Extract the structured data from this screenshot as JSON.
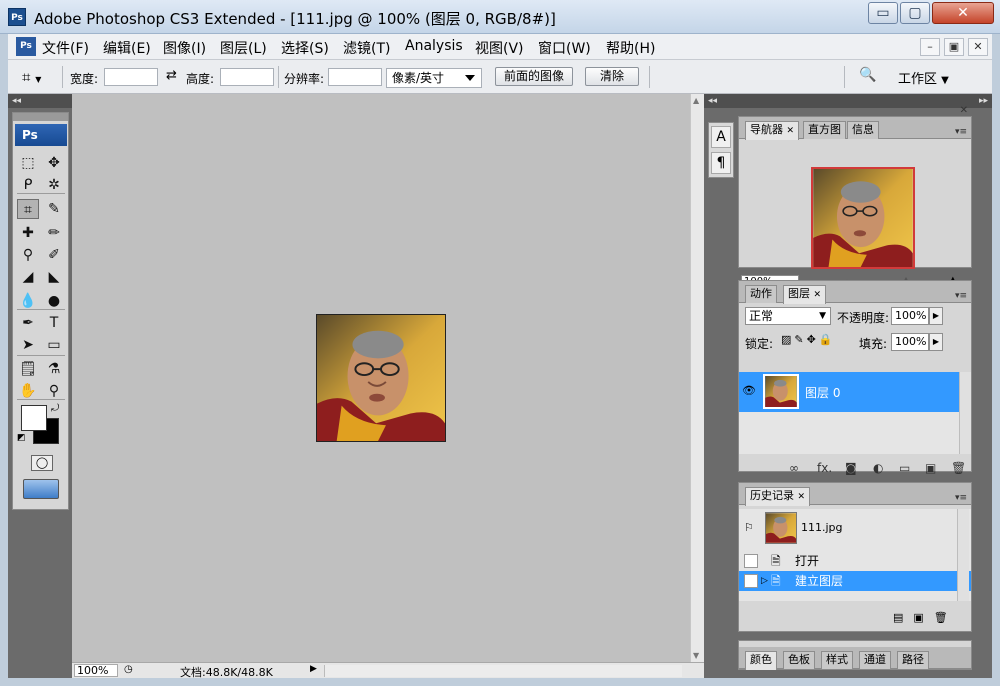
{
  "window": {
    "title": "Adobe Photoshop CS3 Extended - [111.jpg @ 100% (图层 0, RGB/8#)]",
    "app_icon": "Ps",
    "min_icon": "▭",
    "max_icon": "▢",
    "close_icon": "✕"
  },
  "menubar": {
    "logo": "Ps",
    "items": [
      "文件(F)",
      "编辑(E)",
      "图像(I)",
      "图层(L)",
      "选择(S)",
      "滤镜(T)",
      "Analysis",
      "视图(V)",
      "窗口(W)",
      "帮助(H)"
    ],
    "mdi_min": "–",
    "mdi_restore": "▣",
    "mdi_close": "✕"
  },
  "options": {
    "tool_icon": "crop-icon",
    "width_label": "宽度:",
    "width_value": "",
    "swap_icon": "⇄",
    "height_label": "高度:",
    "height_value": "",
    "resolution_label": "分辨率:",
    "resolution_value": "",
    "unit_select": "像素/英寸",
    "front_image_button": "前面的图像",
    "clear_button": "清除",
    "workspace_label": "工作区",
    "workspace_arrow": "▼"
  },
  "toolbox": {
    "logo": "Ps",
    "tools": [
      {
        "name": "marquee-tool-icon",
        "glyph": "⬚"
      },
      {
        "name": "move-tool-icon",
        "glyph": "✥"
      },
      {
        "name": "lasso-tool-icon",
        "glyph": "ᑭ"
      },
      {
        "name": "magic-wand-tool-icon",
        "glyph": "✲"
      },
      {
        "name": "crop-tool-icon",
        "glyph": "⌗"
      },
      {
        "name": "slice-tool-icon",
        "glyph": "✎"
      },
      {
        "name": "healing-brush-tool-icon",
        "glyph": "✚"
      },
      {
        "name": "brush-tool-icon",
        "glyph": "✏"
      },
      {
        "name": "clone-stamp-tool-icon",
        "glyph": "⚲"
      },
      {
        "name": "history-brush-tool-icon",
        "glyph": "✐"
      },
      {
        "name": "eraser-tool-icon",
        "glyph": "◢"
      },
      {
        "name": "paint-bucket-tool-icon",
        "glyph": "◣"
      },
      {
        "name": "blur-tool-icon",
        "glyph": "💧"
      },
      {
        "name": "dodge-tool-icon",
        "glyph": "●"
      },
      {
        "name": "pen-tool-icon",
        "glyph": "✒"
      },
      {
        "name": "type-tool-icon",
        "glyph": "T"
      },
      {
        "name": "path-selection-tool-icon",
        "glyph": "➤"
      },
      {
        "name": "rectangle-tool-icon",
        "glyph": "▭"
      },
      {
        "name": "notes-tool-icon",
        "glyph": "🗒"
      },
      {
        "name": "eyedropper-tool-icon",
        "glyph": "⚗"
      },
      {
        "name": "hand-tool-icon",
        "glyph": "✋"
      },
      {
        "name": "zoom-tool-icon",
        "glyph": "⚲"
      }
    ],
    "quick_mask_icon": "◯",
    "screen_mode_icon": "▭"
  },
  "dock": {
    "collapse_icon": "◂◂",
    "expand_icon": "▸▸",
    "character_icon": "A",
    "paragraph_icon": "¶"
  },
  "navigator": {
    "tabs": [
      "导航器",
      "直方图",
      "信息"
    ],
    "zoom_value": "100%",
    "zoom_out_icon": "▴",
    "zoom_in_icon": "▲"
  },
  "layers": {
    "tabs": [
      "动作",
      "图层"
    ],
    "blend_mode": "正常",
    "opacity_label": "不透明度:",
    "opacity_value": "100%",
    "lock_label": "锁定:",
    "fill_label": "填充:",
    "fill_value": "100%",
    "layer_name": "图层 0",
    "eye_icon": "👁",
    "footer_icons": [
      "∞",
      "fx.",
      "◙",
      "◐",
      "▭",
      "▣",
      "🗑"
    ]
  },
  "history": {
    "tabs": [
      "历史记录"
    ],
    "snapshot_name": "111.jpg",
    "steps": [
      "打开",
      "建立图层"
    ]
  },
  "bottom_panel": {
    "tabs": [
      "颜色",
      "色板",
      "样式",
      "通道",
      "路径"
    ]
  },
  "status": {
    "zoom": "100%",
    "doc_info": "文档:48.8K/48.8K",
    "arrow": "▶"
  },
  "colors": {
    "selection_blue": "#3399ff",
    "workspace_gray": "#c0c0c0",
    "panel_dark": "#6b6b6b",
    "nav_frame_red": "#d23a3a"
  }
}
